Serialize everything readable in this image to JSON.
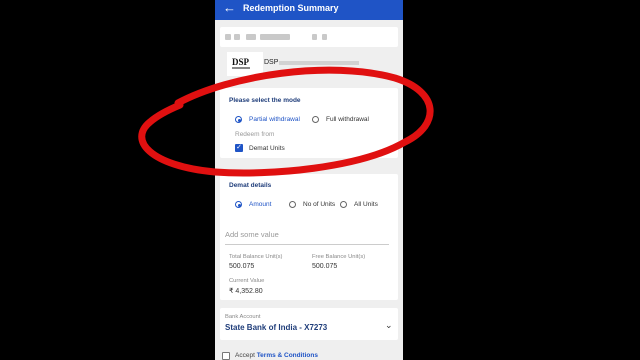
{
  "header": {
    "title": "Redemption Summary",
    "back_icon": "arrow-left-icon"
  },
  "fund": {
    "logo_text": "DSP",
    "name": "DSP"
  },
  "mode": {
    "title": "Please select the mode",
    "options": [
      "Partial withdrawal",
      "Full withdrawal"
    ],
    "selected": 0,
    "redeem_from_label": "Redeem from",
    "redeem_from_option": "Demat Units",
    "redeem_from_checked": true
  },
  "demat": {
    "title": "Demat details",
    "options": [
      "Amount",
      "No of Units",
      "All Units"
    ],
    "selected": 0,
    "input_placeholder": "Add some value",
    "total_balance_label": "Total Balance Unit(s)",
    "total_balance_value": "500.075",
    "free_balance_label": "Free Balance Unit(s)",
    "free_balance_value": "500.075",
    "current_value_label": "Current Value",
    "current_value": "₹ 4,352.80"
  },
  "bank": {
    "label": "Bank Account",
    "value": "State Bank of India - X7273"
  },
  "terms": {
    "prefix": "Accept",
    "link": "Terms & Conditions"
  },
  "colors": {
    "primary": "#1f54c6",
    "annotation": "#e01010",
    "background": "#efefef"
  }
}
